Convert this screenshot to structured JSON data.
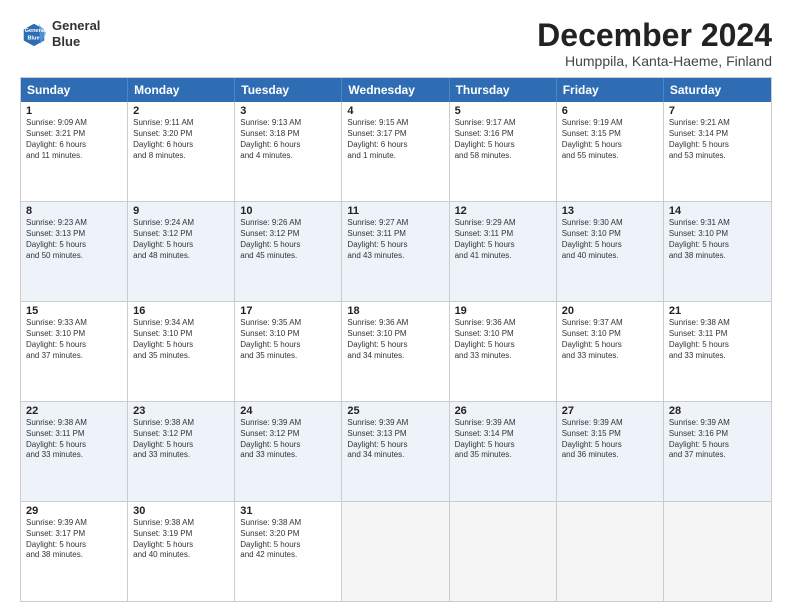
{
  "header": {
    "logo_line1": "General",
    "logo_line2": "Blue",
    "month": "December 2024",
    "location": "Humppila, Kanta-Haeme, Finland"
  },
  "days_of_week": [
    "Sunday",
    "Monday",
    "Tuesday",
    "Wednesday",
    "Thursday",
    "Friday",
    "Saturday"
  ],
  "rows": [
    {
      "alt": false,
      "cells": [
        {
          "day": "1",
          "lines": [
            "Sunrise: 9:09 AM",
            "Sunset: 3:21 PM",
            "Daylight: 6 hours",
            "and 11 minutes."
          ]
        },
        {
          "day": "2",
          "lines": [
            "Sunrise: 9:11 AM",
            "Sunset: 3:20 PM",
            "Daylight: 6 hours",
            "and 8 minutes."
          ]
        },
        {
          "day": "3",
          "lines": [
            "Sunrise: 9:13 AM",
            "Sunset: 3:18 PM",
            "Daylight: 6 hours",
            "and 4 minutes."
          ]
        },
        {
          "day": "4",
          "lines": [
            "Sunrise: 9:15 AM",
            "Sunset: 3:17 PM",
            "Daylight: 6 hours",
            "and 1 minute."
          ]
        },
        {
          "day": "5",
          "lines": [
            "Sunrise: 9:17 AM",
            "Sunset: 3:16 PM",
            "Daylight: 5 hours",
            "and 58 minutes."
          ]
        },
        {
          "day": "6",
          "lines": [
            "Sunrise: 9:19 AM",
            "Sunset: 3:15 PM",
            "Daylight: 5 hours",
            "and 55 minutes."
          ]
        },
        {
          "day": "7",
          "lines": [
            "Sunrise: 9:21 AM",
            "Sunset: 3:14 PM",
            "Daylight: 5 hours",
            "and 53 minutes."
          ]
        }
      ]
    },
    {
      "alt": true,
      "cells": [
        {
          "day": "8",
          "lines": [
            "Sunrise: 9:23 AM",
            "Sunset: 3:13 PM",
            "Daylight: 5 hours",
            "and 50 minutes."
          ]
        },
        {
          "day": "9",
          "lines": [
            "Sunrise: 9:24 AM",
            "Sunset: 3:12 PM",
            "Daylight: 5 hours",
            "and 48 minutes."
          ]
        },
        {
          "day": "10",
          "lines": [
            "Sunrise: 9:26 AM",
            "Sunset: 3:12 PM",
            "Daylight: 5 hours",
            "and 45 minutes."
          ]
        },
        {
          "day": "11",
          "lines": [
            "Sunrise: 9:27 AM",
            "Sunset: 3:11 PM",
            "Daylight: 5 hours",
            "and 43 minutes."
          ]
        },
        {
          "day": "12",
          "lines": [
            "Sunrise: 9:29 AM",
            "Sunset: 3:11 PM",
            "Daylight: 5 hours",
            "and 41 minutes."
          ]
        },
        {
          "day": "13",
          "lines": [
            "Sunrise: 9:30 AM",
            "Sunset: 3:10 PM",
            "Daylight: 5 hours",
            "and 40 minutes."
          ]
        },
        {
          "day": "14",
          "lines": [
            "Sunrise: 9:31 AM",
            "Sunset: 3:10 PM",
            "Daylight: 5 hours",
            "and 38 minutes."
          ]
        }
      ]
    },
    {
      "alt": false,
      "cells": [
        {
          "day": "15",
          "lines": [
            "Sunrise: 9:33 AM",
            "Sunset: 3:10 PM",
            "Daylight: 5 hours",
            "and 37 minutes."
          ]
        },
        {
          "day": "16",
          "lines": [
            "Sunrise: 9:34 AM",
            "Sunset: 3:10 PM",
            "Daylight: 5 hours",
            "and 35 minutes."
          ]
        },
        {
          "day": "17",
          "lines": [
            "Sunrise: 9:35 AM",
            "Sunset: 3:10 PM",
            "Daylight: 5 hours",
            "and 35 minutes."
          ]
        },
        {
          "day": "18",
          "lines": [
            "Sunrise: 9:36 AM",
            "Sunset: 3:10 PM",
            "Daylight: 5 hours",
            "and 34 minutes."
          ]
        },
        {
          "day": "19",
          "lines": [
            "Sunrise: 9:36 AM",
            "Sunset: 3:10 PM",
            "Daylight: 5 hours",
            "and 33 minutes."
          ]
        },
        {
          "day": "20",
          "lines": [
            "Sunrise: 9:37 AM",
            "Sunset: 3:10 PM",
            "Daylight: 5 hours",
            "and 33 minutes."
          ]
        },
        {
          "day": "21",
          "lines": [
            "Sunrise: 9:38 AM",
            "Sunset: 3:11 PM",
            "Daylight: 5 hours",
            "and 33 minutes."
          ]
        }
      ]
    },
    {
      "alt": true,
      "cells": [
        {
          "day": "22",
          "lines": [
            "Sunrise: 9:38 AM",
            "Sunset: 3:11 PM",
            "Daylight: 5 hours",
            "and 33 minutes."
          ]
        },
        {
          "day": "23",
          "lines": [
            "Sunrise: 9:38 AM",
            "Sunset: 3:12 PM",
            "Daylight: 5 hours",
            "and 33 minutes."
          ]
        },
        {
          "day": "24",
          "lines": [
            "Sunrise: 9:39 AM",
            "Sunset: 3:12 PM",
            "Daylight: 5 hours",
            "and 33 minutes."
          ]
        },
        {
          "day": "25",
          "lines": [
            "Sunrise: 9:39 AM",
            "Sunset: 3:13 PM",
            "Daylight: 5 hours",
            "and 34 minutes."
          ]
        },
        {
          "day": "26",
          "lines": [
            "Sunrise: 9:39 AM",
            "Sunset: 3:14 PM",
            "Daylight: 5 hours",
            "and 35 minutes."
          ]
        },
        {
          "day": "27",
          "lines": [
            "Sunrise: 9:39 AM",
            "Sunset: 3:15 PM",
            "Daylight: 5 hours",
            "and 36 minutes."
          ]
        },
        {
          "day": "28",
          "lines": [
            "Sunrise: 9:39 AM",
            "Sunset: 3:16 PM",
            "Daylight: 5 hours",
            "and 37 minutes."
          ]
        }
      ]
    },
    {
      "alt": false,
      "cells": [
        {
          "day": "29",
          "lines": [
            "Sunrise: 9:39 AM",
            "Sunset: 3:17 PM",
            "Daylight: 5 hours",
            "and 38 minutes."
          ]
        },
        {
          "day": "30",
          "lines": [
            "Sunrise: 9:38 AM",
            "Sunset: 3:19 PM",
            "Daylight: 5 hours",
            "and 40 minutes."
          ]
        },
        {
          "day": "31",
          "lines": [
            "Sunrise: 9:38 AM",
            "Sunset: 3:20 PM",
            "Daylight: 5 hours",
            "and 42 minutes."
          ]
        },
        {
          "day": "",
          "lines": []
        },
        {
          "day": "",
          "lines": []
        },
        {
          "day": "",
          "lines": []
        },
        {
          "day": "",
          "lines": []
        }
      ]
    }
  ]
}
